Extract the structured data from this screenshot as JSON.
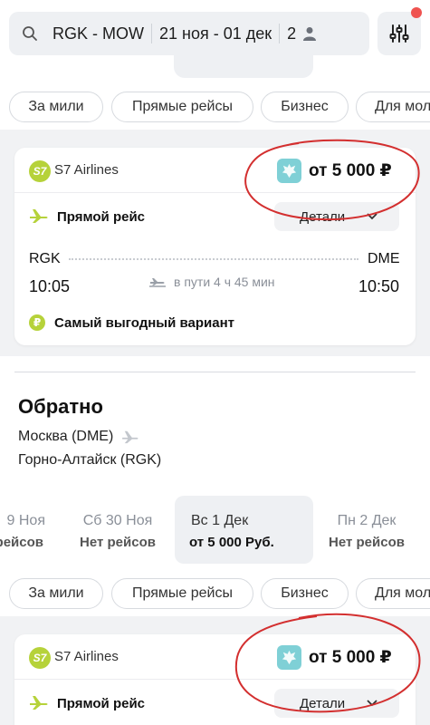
{
  "search": {
    "route": "RGK - MOW",
    "dates": "21 ноя - 01 дек",
    "passengers": "2"
  },
  "filters": [
    "За мили",
    "Прямые рейсы",
    "Бизнес",
    "Для мол"
  ],
  "cards": [
    {
      "airline": "S7 Airlines",
      "logo_text": "S7",
      "price": "от 5 000 ₽",
      "direct": "Прямой рейс",
      "details": "Детали",
      "from_code": "RGK",
      "to_code": "DME",
      "dep_time": "10:05",
      "arr_time": "10:50",
      "duration": "в пути 4 ч 45 мин",
      "best": "Самый выгодный вариант",
      "best_icon": "₽"
    },
    {
      "airline": "S7 Airlines",
      "logo_text": "S7",
      "price": "от 5 000 ₽",
      "direct": "Прямой рейс",
      "details": "Детали"
    }
  ],
  "return": {
    "title": "Обратно",
    "from": "Москва (DME)",
    "to": "Горно-Алтайск (RGK)"
  },
  "dates": [
    {
      "day": "9 Ноя",
      "status": "рейсов"
    },
    {
      "day": "Сб 30 Ноя",
      "status": "Нет рейсов"
    },
    {
      "day": "Вс 1 Дек",
      "status": "от 5 000 Руб.",
      "selected": true
    },
    {
      "day": "Пн 2 Дек",
      "status": "Нет рейсов"
    }
  ],
  "colors": {
    "accent_green": "#b6d23a",
    "notification": "#ef5350",
    "emblem": "#7fd0d6",
    "annotation": "#d32f2f"
  }
}
